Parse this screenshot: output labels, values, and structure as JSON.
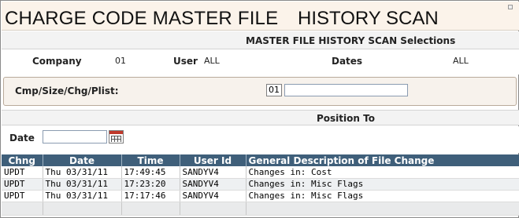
{
  "window": {
    "title_left": "CHARGE CODE MASTER FILE",
    "title_right": "HISTORY SCAN"
  },
  "selections": {
    "header": "MASTER FILE HISTORY SCAN  Selections",
    "company_label": "Company",
    "company_value": "01",
    "user_label": "User",
    "user_value": "ALL",
    "dates_label": "Dates",
    "dates_value": "ALL"
  },
  "cmp": {
    "label": "Cmp/Size/Chg/Plist:",
    "code": "01",
    "value": ""
  },
  "position": {
    "header": "Position To",
    "date_label": "Date",
    "date_value": ""
  },
  "table": {
    "columns": [
      "Chng",
      "Date",
      "Time",
      "User Id",
      "General Description of File Change"
    ],
    "rows": [
      [
        "UPDT",
        "Thu 03/31/11",
        "17:49:45",
        "SANDYV4",
        "Changes in: Cost"
      ],
      [
        "UPDT",
        "Thu 03/31/11",
        "17:23:20",
        "SANDYV4",
        "Changes in: Misc Flags"
      ],
      [
        "UPDT",
        "Thu 03/31/11",
        "17:17:46",
        "SANDYV4",
        "Changes in: Misc Flags"
      ]
    ]
  },
  "colors": {
    "title_bg": "#fbf3ea",
    "grid_header_bg": "#3f5f7a",
    "section_bg": "#f3f3f3"
  }
}
